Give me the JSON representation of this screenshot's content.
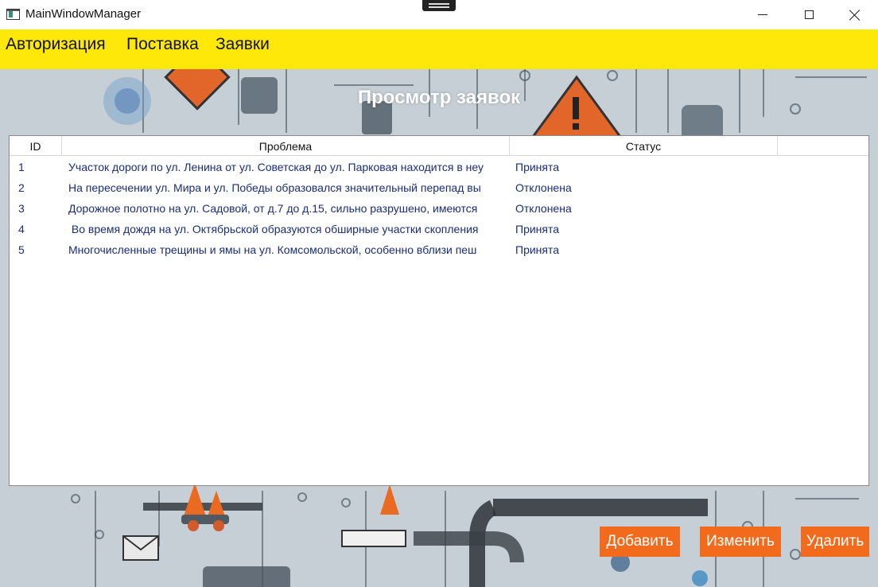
{
  "window": {
    "title": "MainWindowManager",
    "icons": {
      "app": "app-window-icon",
      "drag": "drag-handle-icon",
      "minimize": "minimize-icon",
      "maximize": "maximize-icon",
      "close": "close-icon"
    }
  },
  "menu": {
    "items": [
      {
        "label": "Авторизация"
      },
      {
        "label": "Поставка"
      },
      {
        "label": "Заявки"
      }
    ],
    "background": "#fde80a"
  },
  "page": {
    "heading": "Просмотр заявок"
  },
  "table": {
    "columns": [
      "ID",
      "Проблема",
      "Статус",
      ""
    ],
    "rows": [
      {
        "id": "1",
        "problem": "Участок дороги по ул. Ленина от ул. Советская до ул. Парковая находится в неу",
        "status": "Принята"
      },
      {
        "id": "2",
        "problem": "На пересечении ул. Мира и ул. Победы образовался значительный перепад вы",
        "status": "Отклонена"
      },
      {
        "id": "3",
        "problem": "Дорожное полотно на ул. Садовой, от д.7 до д.15, сильно разрушено, имеются",
        "status": "Отклонена"
      },
      {
        "id": "4",
        "problem": " Во время дождя на ул. Октябрьской образуются обширные участки скопления",
        "status": "Принята"
      },
      {
        "id": "5",
        "problem": "Многочисленные трещины и ямы на ул. Комсомольской, особенно вблизи пеш",
        "status": "Принята"
      }
    ],
    "text_color": "#1a2d7a"
  },
  "actions": {
    "add": "Добавить",
    "edit": "Изменить",
    "delete": "Удалить",
    "color": "#f26b1d"
  }
}
